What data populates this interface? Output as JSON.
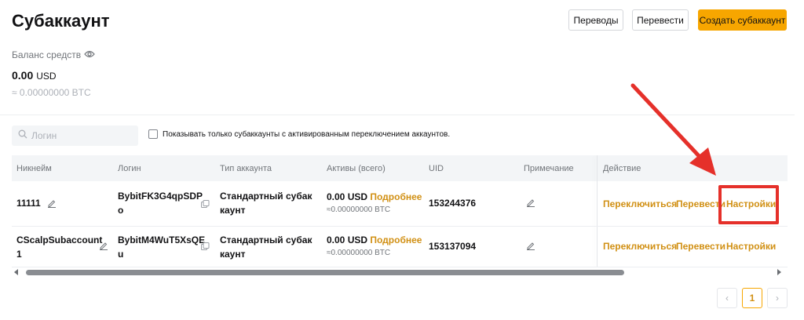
{
  "header": {
    "title": "Субаккаунт",
    "buttons": {
      "transfers": "Переводы",
      "transfer": "Перевести",
      "create": "Создать субаккаунт"
    }
  },
  "balance": {
    "label": "Баланс средств",
    "value": "0.00",
    "unit": "USD",
    "btc": "≈ 0.00000000 BTC"
  },
  "filters": {
    "search_placeholder": "Логин",
    "checkbox_label": "Показывать только субаккаунты с активированным переключением аккаунтов."
  },
  "table": {
    "columns": [
      "Никнейм",
      "Логин",
      "Тип аккаунта",
      "Активы (всего)",
      "UID",
      "Примечание",
      "Действие"
    ],
    "rows": [
      {
        "nickname": "11111",
        "login_line1": "BybitFK3G4qpSDP",
        "login_line2": "o",
        "type_line1": "Стандартный субак",
        "type_line2": "каунт",
        "assets_usd": "0.00 USD",
        "assets_more": "Подробнее",
        "assets_btc": "≈0.00000000 BTC",
        "uid": "153244376",
        "actions": [
          "Переключиться",
          "Перевести",
          "Настройки"
        ]
      },
      {
        "nickname_line1": "CScalpSubaccount",
        "nickname_line2": "1",
        "login_line1": "BybitM4WuT5XsQE",
        "login_line2": "u",
        "type_line1": "Стандартный субак",
        "type_line2": "каунт",
        "assets_usd": "0.00 USD",
        "assets_more": "Подробнее",
        "assets_btc": "≈0.00000000 BTC",
        "uid": "153137094",
        "actions": [
          "Переключиться",
          "Перевести",
          "Настройки"
        ]
      }
    ]
  },
  "pagination": {
    "prev": "‹",
    "current": "1",
    "next": "›"
  },
  "colors": {
    "accent": "#f7a600",
    "link": "#d19014",
    "annotation": "#e5302a"
  }
}
